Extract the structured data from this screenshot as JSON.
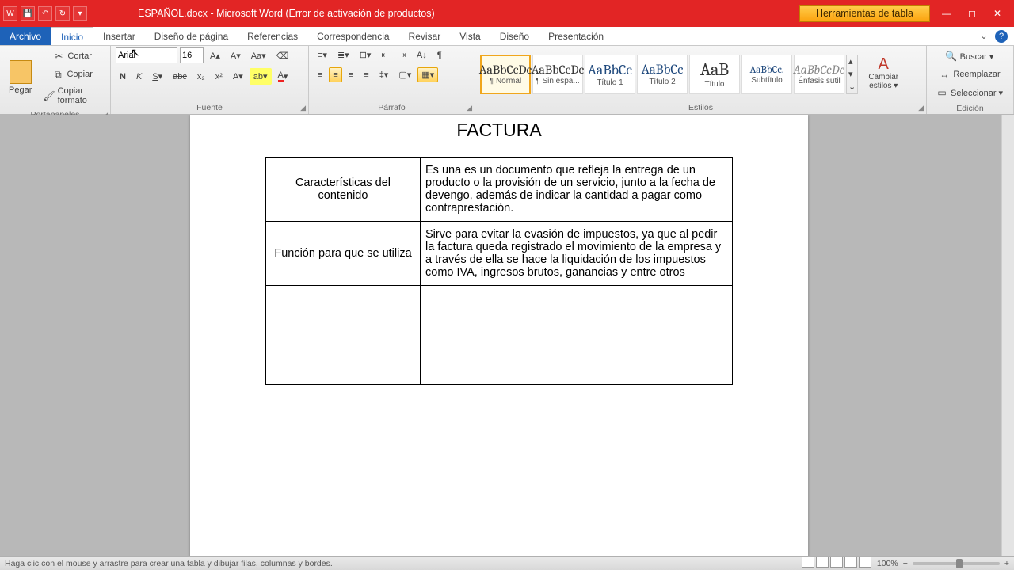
{
  "title": "ESPAÑOL.docx - Microsoft Word (Error de activación de productos)",
  "tableTools": "Herramientas de tabla",
  "tabs": {
    "archivo": "Archivo",
    "inicio": "Inicio",
    "insertar": "Insertar",
    "diseno_pagina": "Diseño de página",
    "referencias": "Referencias",
    "correspondencia": "Correspondencia",
    "revisar": "Revisar",
    "vista": "Vista",
    "diseno": "Diseño",
    "presentacion": "Presentación"
  },
  "clipboard": {
    "paste": "Pegar",
    "cut": "Cortar",
    "copy": "Copiar",
    "format": "Copiar formato",
    "label": "Portapapeles"
  },
  "font": {
    "name": "Arial",
    "size": "16",
    "label": "Fuente"
  },
  "paragraph": {
    "label": "Párrafo"
  },
  "styles": {
    "label": "Estilos",
    "change": "Cambiar estilos ▾",
    "items": [
      {
        "prev": "AaBbCcDc",
        "name": "¶ Normal"
      },
      {
        "prev": "AaBbCcDc",
        "name": "¶ Sin espa..."
      },
      {
        "prev": "AaBbCc",
        "name": "Título 1"
      },
      {
        "prev": "AaBbCc",
        "name": "Título 2"
      },
      {
        "prev": "AaB",
        "name": "Título"
      },
      {
        "prev": "AaBbCc.",
        "name": "Subtítulo"
      },
      {
        "prev": "AaBbCcDc",
        "name": "Énfasis sutil"
      }
    ]
  },
  "editing": {
    "label": "Edición",
    "find": "Buscar ▾",
    "replace": "Reemplazar",
    "select": "Seleccionar ▾"
  },
  "doc": {
    "heading": "FACTURA",
    "r1l": "Características del contenido",
    "r1r": "Es una es un documento que refleja la entrega de un producto o la provisión de un servicio, junto a la fecha de devengo, además de indicar la cantidad a pagar como contraprestación.",
    "r2l": "Función para que se utiliza",
    "r2r": "Sirve para evitar la evasión de impuestos, ya que al pedir la factura queda registrado el movimiento de la empresa y a través de ella se hace la liquidación de los impuestos como IVA, ingresos brutos, ganancias y entre otros"
  },
  "status": {
    "hint": "Haga clic con el mouse y arrastre para crear una tabla y dibujar filas, columnas y bordes.",
    "zoom": "100%"
  }
}
